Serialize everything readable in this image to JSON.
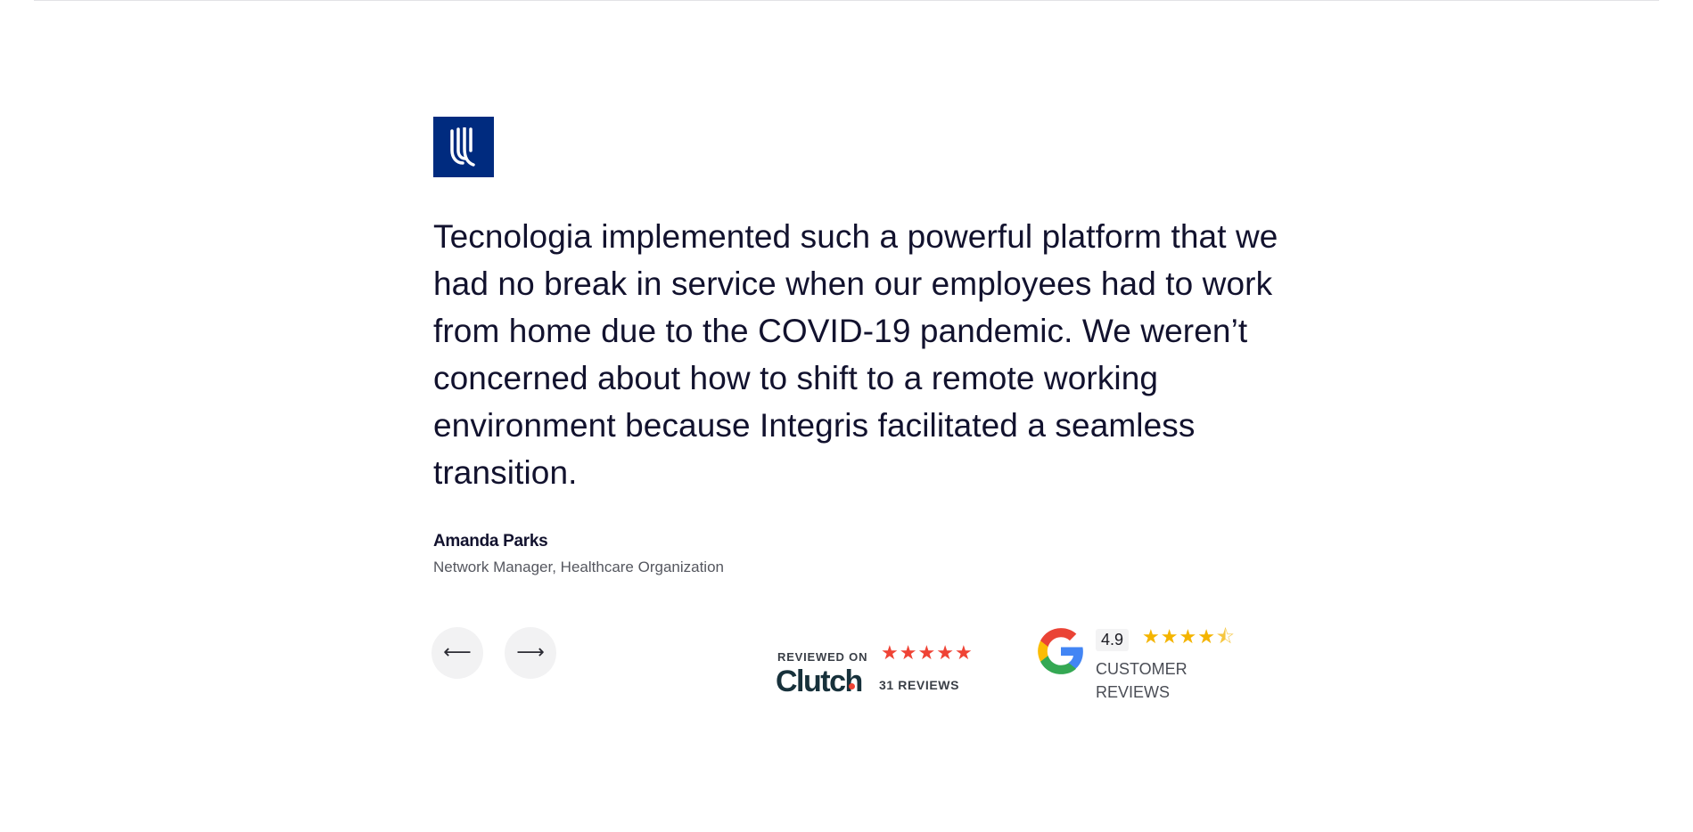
{
  "testimonial": {
    "quote": "Tecnologia implemented such a powerful platform that we had no break in service when our employees had to work from home due to the COVID-19 pandemic. We weren’t concerned about how to shift to a remote working environment because Integris facilitated a seamless transition.",
    "author_name": "Amanda Parks",
    "author_title": "Network Manager, Healthcare Organization",
    "logo_icon": "unitedhealthcare-u-icon",
    "logo_color": "#002b7f"
  },
  "navigation": {
    "prev_icon": "arrow-left-icon",
    "prev_glyph": "⟵",
    "next_icon": "arrow-right-icon",
    "next_glyph": "⟶"
  },
  "clutch": {
    "reviewed_on": "REVIEWED ON",
    "brand": "Clutch",
    "reviews": "31 REVIEWS",
    "stars": 5,
    "star_color": "#ef4335"
  },
  "google": {
    "rating": "4.9",
    "stars": 4.5,
    "label": "CUSTOMER REVIEWS",
    "star_color": "#f4b400"
  }
}
